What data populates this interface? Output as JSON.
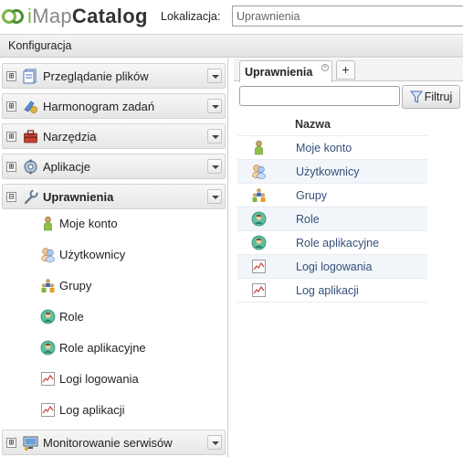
{
  "header": {
    "logo_text": "iMapCatalog",
    "localization_label": "Lokalizacja:",
    "localization_value": "Uprawnienia"
  },
  "config_bar": {
    "title": "Konfiguracja"
  },
  "sidebar": {
    "sections": [
      {
        "label": "Przeglądanie plików",
        "icon": "file-browser-icon",
        "expand": "⊞"
      },
      {
        "label": "Harmonogram zadań",
        "icon": "scheduler-icon",
        "expand": "⊞"
      },
      {
        "label": "Narzędzia",
        "icon": "toolbox-icon",
        "expand": "⊞"
      },
      {
        "label": "Aplikacje",
        "icon": "applications-icon",
        "expand": "⊞"
      },
      {
        "label": "Uprawnienia",
        "icon": "wrench-icon",
        "expand": "⊟"
      },
      {
        "label": "Monitorowanie serwisów",
        "icon": "monitor-icon",
        "expand": "⊞"
      }
    ],
    "sub_items": [
      {
        "label": "Moje konto",
        "icon": "user-icon"
      },
      {
        "label": "Użytkownicy",
        "icon": "users-icon"
      },
      {
        "label": "Grupy",
        "icon": "group-icon"
      },
      {
        "label": "Role",
        "icon": "role-icon"
      },
      {
        "label": "Role aplikacyjne",
        "icon": "role-icon"
      },
      {
        "label": "Logi logowania",
        "icon": "log-chart-icon"
      },
      {
        "label": "Log aplikacji",
        "icon": "log-chart-icon"
      }
    ]
  },
  "main": {
    "tab_label": "Uprawnienia",
    "tab_add": "+",
    "filter_placeholder": "",
    "filter_button": "Filtruj",
    "grid_header": "Nazwa",
    "rows": [
      {
        "label": "Moje konto",
        "icon": "user-icon"
      },
      {
        "label": "Użytkownicy",
        "icon": "users-icon"
      },
      {
        "label": "Grupy",
        "icon": "group-icon"
      },
      {
        "label": "Role",
        "icon": "role-icon"
      },
      {
        "label": "Role aplikacyjne",
        "icon": "role-icon"
      },
      {
        "label": "Logi logowania",
        "icon": "log-chart-icon"
      },
      {
        "label": "Log aplikacji",
        "icon": "log-chart-icon"
      }
    ]
  },
  "colors": {
    "brand_green": "#7ab648",
    "link_blue": "#35507a",
    "row_alt": "#f2f5fa"
  }
}
